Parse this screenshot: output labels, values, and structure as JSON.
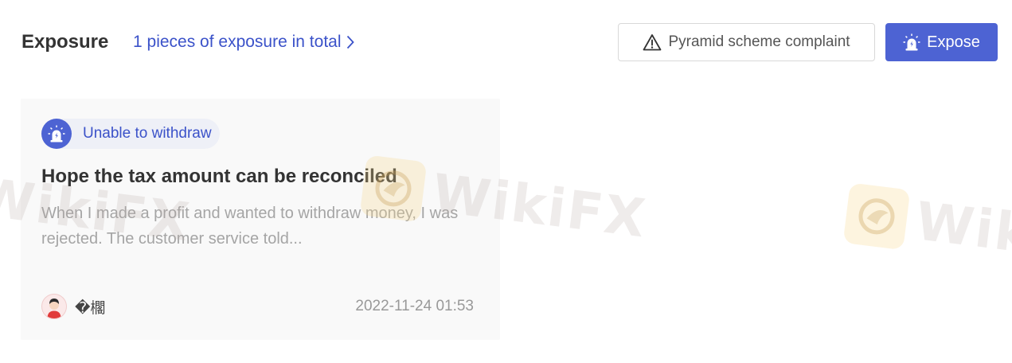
{
  "header": {
    "title": "Exposure",
    "total_link": "1 pieces of exposure in total",
    "complaint_button": "Pyramid scheme complaint",
    "expose_button": "Expose"
  },
  "card": {
    "tag": "Unable to withdraw",
    "title": "Hope the tax amount can be reconciled",
    "body": "When I made a profit and wanted to withdraw money, I was rejected. The customer service told...",
    "author": "�櫊",
    "date": "2022-11-24 01:53"
  },
  "watermark": {
    "text": "WikiFX"
  },
  "colors": {
    "accent": "#4d63d3",
    "link": "#3b52c9",
    "card_bg": "#f9f9f9"
  },
  "icons": {
    "complaint": "warning-triangle-icon",
    "expose": "alarm-siren-icon",
    "chevron": "chevron-right-icon"
  }
}
